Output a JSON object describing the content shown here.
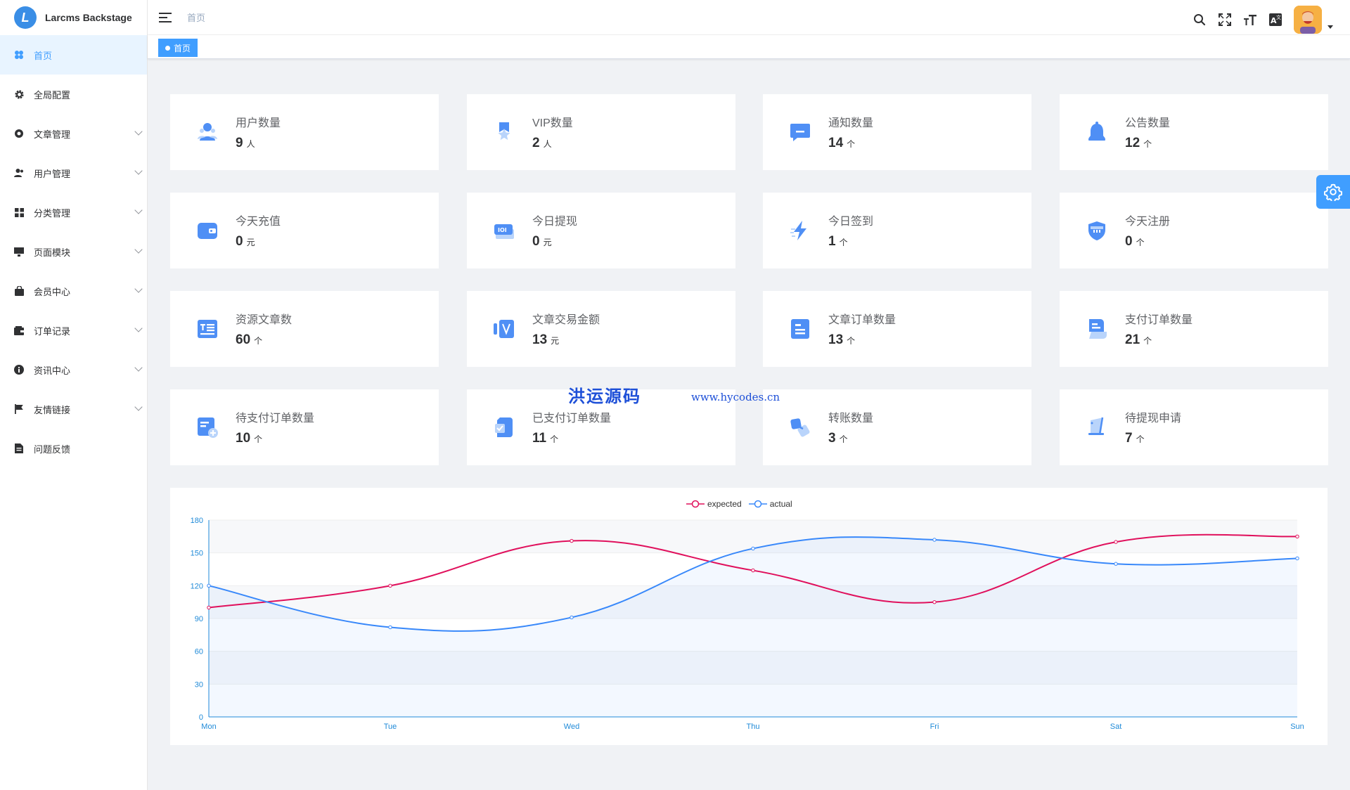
{
  "app": {
    "logo_letter": "L",
    "name": "Larcms Backstage"
  },
  "sidebar": {
    "items": [
      {
        "label": "首页",
        "icon": "dashboard-icon",
        "active": true,
        "expandable": false
      },
      {
        "label": "全局配置",
        "icon": "gear-icon",
        "active": false,
        "expandable": false
      },
      {
        "label": "文章管理",
        "icon": "article-icon",
        "active": false,
        "expandable": true
      },
      {
        "label": "用户管理",
        "icon": "users-icon",
        "active": false,
        "expandable": true
      },
      {
        "label": "分类管理",
        "icon": "grid-icon",
        "active": false,
        "expandable": true
      },
      {
        "label": "页面模块",
        "icon": "monitor-icon",
        "active": false,
        "expandable": true
      },
      {
        "label": "会员中心",
        "icon": "bag-icon",
        "active": false,
        "expandable": true
      },
      {
        "label": "订单记录",
        "icon": "wallet-icon",
        "active": false,
        "expandable": true
      },
      {
        "label": "资讯中心",
        "icon": "info-icon",
        "active": false,
        "expandable": true
      },
      {
        "label": "友情链接",
        "icon": "flag-icon",
        "active": false,
        "expandable": true
      },
      {
        "label": "问题反馈",
        "icon": "document-icon",
        "active": false,
        "expandable": false
      }
    ]
  },
  "header": {
    "breadcrumb": "首页",
    "tools": [
      "search-icon",
      "fullscreen-icon",
      "font-size-icon",
      "translate-icon"
    ]
  },
  "tags": {
    "active": "首页"
  },
  "cards": [
    {
      "label": "用户数量",
      "value": "9",
      "unit": "人",
      "icon": "user-icon"
    },
    {
      "label": "VIP数量",
      "value": "2",
      "unit": "人",
      "icon": "vip-icon"
    },
    {
      "label": "通知数量",
      "value": "14",
      "unit": "个",
      "icon": "message-icon"
    },
    {
      "label": "公告数量",
      "value": "12",
      "unit": "个",
      "icon": "bell-icon"
    },
    {
      "label": "今天充值",
      "value": "0",
      "unit": "元",
      "icon": "wallet-icon"
    },
    {
      "label": "今日提现",
      "value": "0",
      "unit": "元",
      "icon": "cash-icon"
    },
    {
      "label": "今日签到",
      "value": "1",
      "unit": "个",
      "icon": "lightning-icon"
    },
    {
      "label": "今天注册",
      "value": "0",
      "unit": "个",
      "icon": "shield-icon"
    },
    {
      "label": "资源文章数",
      "value": "60",
      "unit": "个",
      "icon": "article-list-icon"
    },
    {
      "label": "文章交易金额",
      "value": "13",
      "unit": "元",
      "icon": "money-icon"
    },
    {
      "label": "文章订单数量",
      "value": "13",
      "unit": "个",
      "icon": "order-icon"
    },
    {
      "label": "支付订单数量",
      "value": "21",
      "unit": "个",
      "icon": "receipt-icon"
    },
    {
      "label": "待支付订单数量",
      "value": "10",
      "unit": "个",
      "icon": "pending-icon"
    },
    {
      "label": "已支付订单数量",
      "value": "11",
      "unit": "个",
      "icon": "paid-icon"
    },
    {
      "label": "转账数量",
      "value": "3",
      "unit": "个",
      "icon": "transfer-icon"
    },
    {
      "label": "待提现申请",
      "value": "7",
      "unit": "个",
      "icon": "withdraw-icon"
    }
  ],
  "watermark": {
    "title": "洪运源码",
    "url": "www.hycodes.cn"
  },
  "colors": {
    "accent": "#409eff",
    "expected": "#e0105c",
    "actual": "#3888fa"
  },
  "chart_data": {
    "type": "line",
    "categories": [
      "Mon",
      "Tue",
      "Wed",
      "Thu",
      "Fri",
      "Sat",
      "Sun"
    ],
    "series": [
      {
        "name": "expected",
        "values": [
          100,
          120,
          161,
          134,
          105,
          160,
          165
        ]
      },
      {
        "name": "actual",
        "values": [
          120,
          82,
          91,
          154,
          162,
          140,
          145
        ]
      }
    ],
    "ylim": [
      0,
      180
    ],
    "yticks": [
      0,
      30,
      60,
      90,
      120,
      150,
      180
    ],
    "legend": "top-center",
    "smooth": true,
    "grid": true
  }
}
